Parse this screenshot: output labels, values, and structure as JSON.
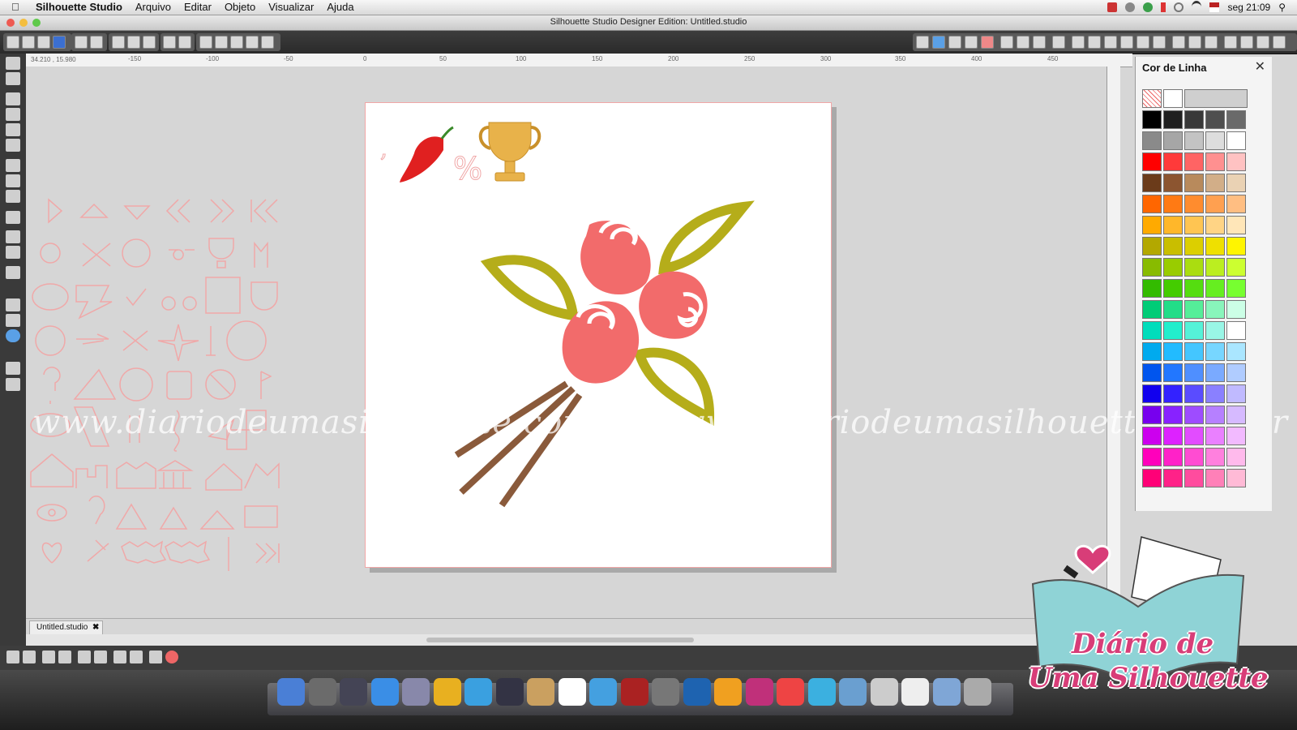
{
  "menubar": {
    "app_name": "Silhouette Studio",
    "items": [
      "Arquivo",
      "Editar",
      "Objeto",
      "Visualizar",
      "Ajuda"
    ],
    "clock": "seg 21:09"
  },
  "window": {
    "title": "Silhouette Studio Designer Edition: Untitled.studio"
  },
  "ruler": {
    "coords": "34.210 , 15.980",
    "ticks": [
      "-150",
      "-100",
      "-50",
      "0",
      "50",
      "100",
      "150",
      "200",
      "250",
      "300",
      "350",
      "400",
      "450"
    ]
  },
  "canvas": {
    "watermark": "www.diariodeumasilhouette.com.br | www.diariodeumasilhouette.com.br",
    "design_glyphs": [
      ",",
      "%"
    ]
  },
  "panel": {
    "title": "Cor de Linha",
    "close": "✕",
    "swatch_rows": [
      [
        "#000000",
        "#1f1f1f",
        "#383838",
        "#4f4f4f",
        "#6a6a6a"
      ],
      [
        "#8a8a8a",
        "#a6a6a6",
        "#c3c3c3",
        "#dddddd",
        "#ffffff"
      ],
      [
        "#ff0000",
        "#ff3a3a",
        "#ff6464",
        "#ff9090",
        "#ffc2c2"
      ],
      [
        "#6b3b1a",
        "#8c5530",
        "#b88a5c",
        "#d2ae88",
        "#ead2b4"
      ],
      [
        "#ff6600",
        "#ff7a14",
        "#ff8c2e",
        "#ffa050",
        "#ffbe82"
      ],
      [
        "#ffaa00",
        "#ffb72a",
        "#ffc552",
        "#ffd485",
        "#ffe6b8"
      ],
      [
        "#b3a800",
        "#c9be00",
        "#dccf00",
        "#efe000",
        "#fff500"
      ],
      [
        "#88bb00",
        "#99cc00",
        "#aadd10",
        "#bbee20",
        "#ccff30"
      ],
      [
        "#33bb00",
        "#44cc00",
        "#55dd10",
        "#66ee20",
        "#77ff30"
      ],
      [
        "#00cc77",
        "#22dd88",
        "#55ee99",
        "#88f5bb",
        "#ccffe6"
      ],
      [
        "#00ddbb",
        "#22eecc",
        "#55f2d8",
        "#99f6e6",
        "#ffffff"
      ],
      [
        "#00aaee",
        "#22bbff",
        "#44c6ff",
        "#77d6ff",
        "#aae6ff"
      ],
      [
        "#0055ee",
        "#2277ff",
        "#4f8fff",
        "#7aaaff",
        "#b0ccff"
      ],
      [
        "#1100ee",
        "#3322ff",
        "#5a4cff",
        "#8a80ff",
        "#c0baff"
      ],
      [
        "#7700ee",
        "#8822ff",
        "#9e4cff",
        "#b680ff",
        "#d6baff"
      ],
      [
        "#cc00ee",
        "#dd22ff",
        "#e24cff",
        "#ea80ff",
        "#f2baff"
      ],
      [
        "#ff00bb",
        "#ff22c8",
        "#ff4cd2",
        "#ff80de",
        "#ffbaec"
      ],
      [
        "#ff0077",
        "#ff2288",
        "#ff4c9e",
        "#ff80b8",
        "#ffbad6"
      ]
    ]
  },
  "document_tab": {
    "label": "Untitled.studio",
    "close": "✖"
  },
  "logo": {
    "line1": "Diário de",
    "line2": "Uma Silhouette"
  },
  "colors": {
    "rose": "#f26b6b",
    "leaf": "#b5ad1a",
    "stem": "#8a5a3b",
    "pepper": "#e02020",
    "trophy": "#e8b24a",
    "ghost_shape": "#f0a8a8",
    "logo_book": "#8fd3d6",
    "logo_heart": "#d83d78"
  }
}
